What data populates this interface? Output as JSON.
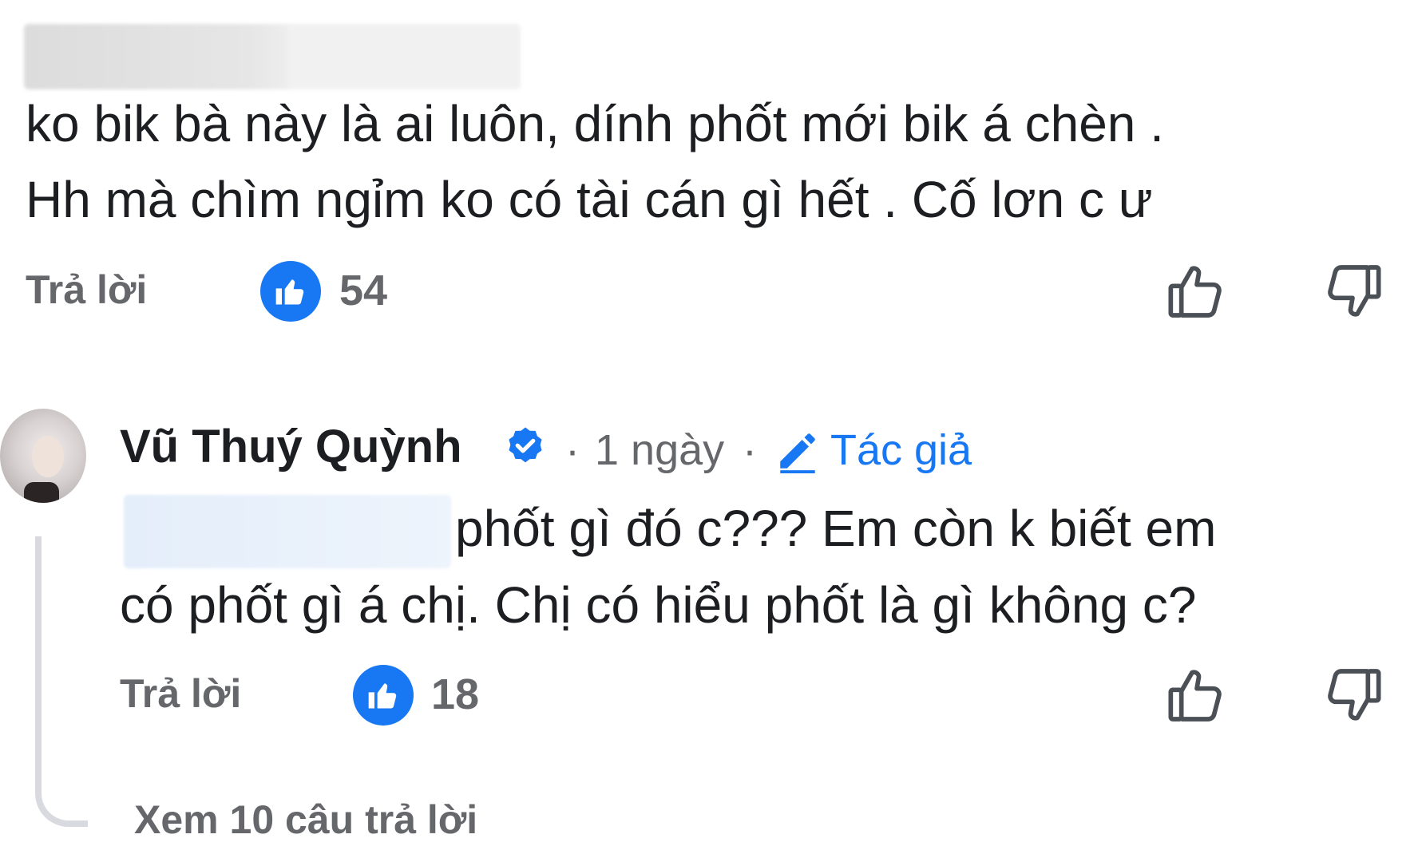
{
  "comment1": {
    "author_name_redacted": "",
    "text_line1": "ko bik bà này là ai luôn, dính phốt mới bik á chèn .",
    "text_line2": "Hh mà chìm ngỉm ko có tài cán gì hết . Cố lơn c ư",
    "reply_label": "Trả lời",
    "like_count": "54"
  },
  "comment2": {
    "author": "Vũ Thuý Quỳnh",
    "separator1": "·",
    "time": "1 ngày",
    "separator2": "·",
    "author_tag": "Tác giả",
    "text_line1": "phốt gì đó c??? Em còn k biết em",
    "text_line2": "có phốt gì á chị. Chị có hiểu phốt là gì không c?",
    "reply_label": "Trả lời",
    "like_count": "18",
    "view_replies": "Xem 10 câu trả lời"
  },
  "colors": {
    "facebook_blue": "#1877f2",
    "secondary_text": "#65676b",
    "primary_text": "#1c1e21"
  },
  "icons": [
    "like-reaction-icon",
    "thumbs-up-outline-icon",
    "thumbs-down-outline-icon",
    "verified-badge-icon",
    "pencil-icon"
  ]
}
